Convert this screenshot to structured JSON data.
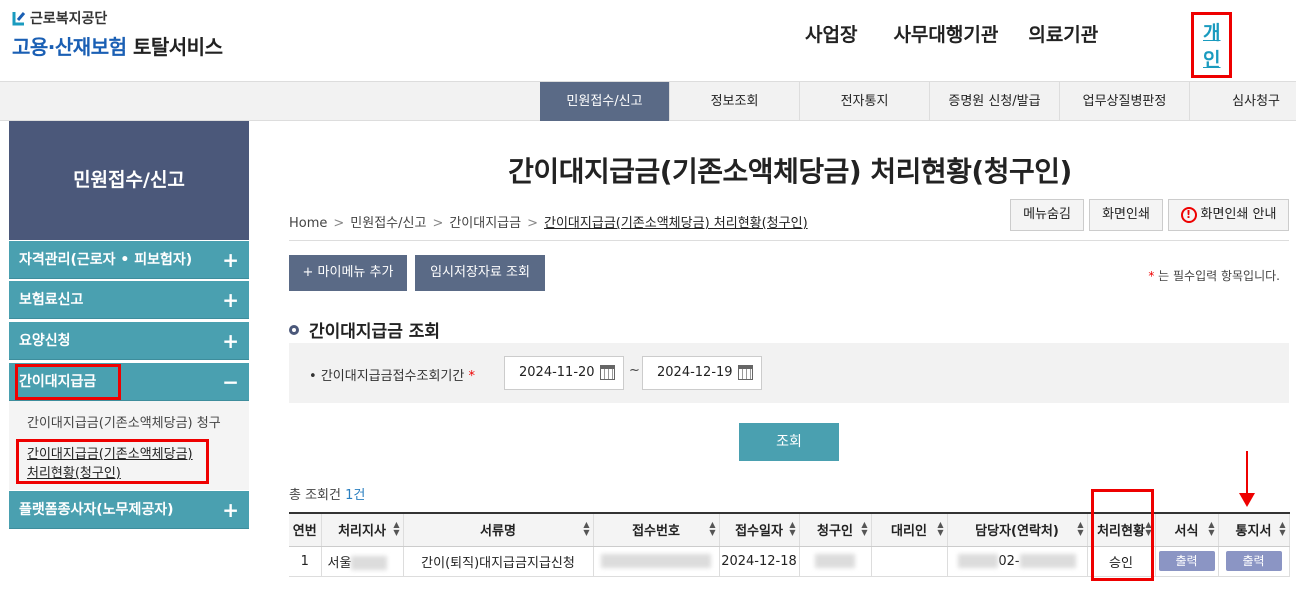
{
  "header": {
    "org_name": "근로복지공단",
    "service_blue": "고용·산재보험",
    "service_dark": "토탈서비스",
    "nav": [
      "사업장",
      "사무대행기관",
      "의료기관",
      "개인"
    ]
  },
  "gnb": [
    "민원접수/신고",
    "정보조회",
    "전자통지",
    "증명원 신청/발급",
    "업무상질병판정",
    "심사청구"
  ],
  "sidebar": {
    "title": "민원접수/신고",
    "menus": [
      "자격관리(근로자 • 피보험자)",
      "보험료신고",
      "요양신청",
      "간이대지급금",
      "플랫폼종사자(노무제공자)"
    ],
    "sub_items": [
      "간이대지급금(기존소액체당금) 청구",
      "간이대지급금(기존소액체당금)",
      "처리현황(청구인)"
    ]
  },
  "main": {
    "title": "간이대지급금(기존소액체당금) 처리현황(청구인)",
    "breadcrumb": [
      "Home",
      "민원접수/신고",
      "간이대지급금",
      "간이대지급금(기존소액체당금) 처리현황(청구인)"
    ],
    "tools": [
      "메뉴숨김",
      "화면인쇄",
      "화면인쇄 안내"
    ],
    "add_menu_label": "+ 마이메뉴 추가",
    "temp_saved_label": "임시저장자료 조회",
    "required_note": "는 필수입력 항목입니다.",
    "section_title": "간이대지급금 조회",
    "search_label": "간이대지급금접수조회기간",
    "date_from": "2024-11-20",
    "date_to": "2024-12-19",
    "query_label": "조회",
    "total_label": "총 조회건",
    "total_count": "1건"
  },
  "table": {
    "headers": [
      "연번",
      "처리지사",
      "서류명",
      "접수번호",
      "접수일자",
      "청구인",
      "대리인",
      "담당자(연락처)",
      "처리현황",
      "서식",
      "통지서"
    ],
    "row": {
      "no": "1",
      "branch": "서울",
      "doc": "간이(퇴직)대지급금지급신청",
      "date": "2024-12-18",
      "contact": "02-",
      "status": "승인",
      "form_btn": "출력",
      "notice_btn": "출력"
    }
  }
}
